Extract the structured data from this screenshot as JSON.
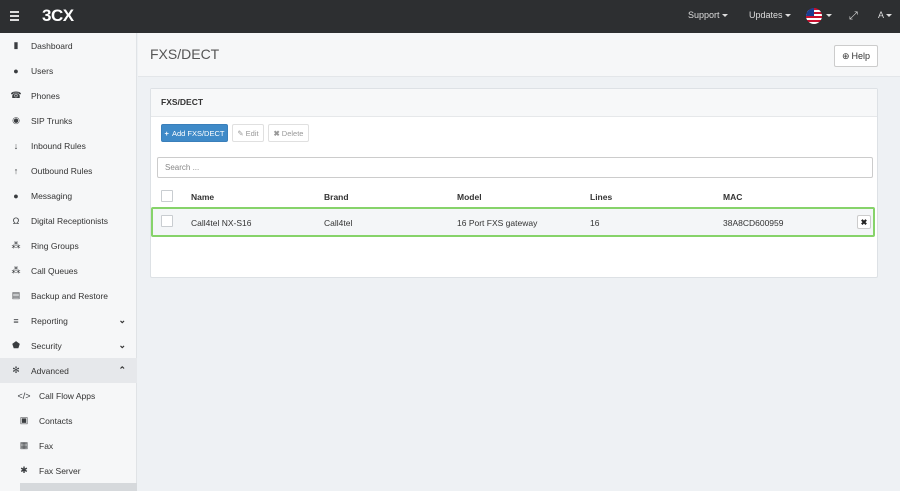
{
  "topbar": {
    "logo": "3CX",
    "menu": [
      "Support",
      "Updates"
    ],
    "user": "A"
  },
  "sidebar": {
    "items": [
      {
        "label": "Dashboard",
        "icon": "bar-chart-icon"
      },
      {
        "label": "Users",
        "icon": "user-icon"
      },
      {
        "label": "Phones",
        "icon": "phone-icon"
      },
      {
        "label": "SIP Trunks",
        "icon": "globe-icon"
      },
      {
        "label": "Inbound Rules",
        "icon": "arrow-down-icon"
      },
      {
        "label": "Outbound Rules",
        "icon": "arrow-up-icon"
      },
      {
        "label": "Messaging",
        "icon": "chat-icon"
      },
      {
        "label": "Digital Receptionists",
        "icon": "headset-icon"
      },
      {
        "label": "Ring Groups",
        "icon": "users-icon"
      },
      {
        "label": "Call Queues",
        "icon": "group-icon"
      },
      {
        "label": "Backup and Restore",
        "icon": "database-icon"
      },
      {
        "label": "Reporting",
        "icon": "list-icon"
      },
      {
        "label": "Security",
        "icon": "shield-icon"
      },
      {
        "label": "Advanced",
        "icon": "gear-icon"
      },
      {
        "label": "Call Flow Apps",
        "icon": "code-icon"
      },
      {
        "label": "Contacts",
        "icon": "contact-book-icon"
      },
      {
        "label": "Fax",
        "icon": "fax-icon"
      },
      {
        "label": "Fax Server",
        "icon": "fax-server-icon"
      }
    ]
  },
  "page": {
    "title": "FXS/DECT",
    "help_label": "Help"
  },
  "panel": {
    "title": "FXS/DECT",
    "add_label": "Add FXS/DECT",
    "edit_label": "Edit",
    "delete_label": "Delete",
    "search_placeholder": "Search ..."
  },
  "table": {
    "columns": [
      "Name",
      "Brand",
      "Model",
      "Lines",
      "MAC"
    ],
    "rows": [
      {
        "name": "Call4tel NX-S16",
        "brand": "Call4tel",
        "model": "16 Port FXS gateway",
        "lines": "16",
        "mac": "38A8CD600959"
      }
    ]
  }
}
